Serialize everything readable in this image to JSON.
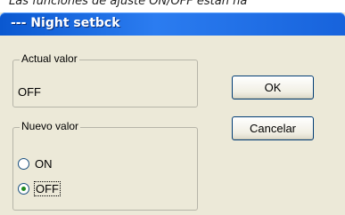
{
  "background": {
    "caption": "Las funciones de ajuste ON/OFF están ha"
  },
  "dialog": {
    "title": "--- Night setbck",
    "actual_group": {
      "legend": "Actual valor",
      "value": "OFF"
    },
    "nuevo_group": {
      "legend": "Nuevo valor",
      "options": [
        {
          "label": "ON",
          "checked": false
        },
        {
          "label": "OFF",
          "checked": true
        }
      ]
    },
    "buttons": {
      "ok": "OK",
      "cancel": "Cancelar"
    }
  },
  "colors": {
    "titlebar": "#2b7cf0",
    "window": "#ece9d8",
    "radio_dot": "#1f8a1f"
  }
}
